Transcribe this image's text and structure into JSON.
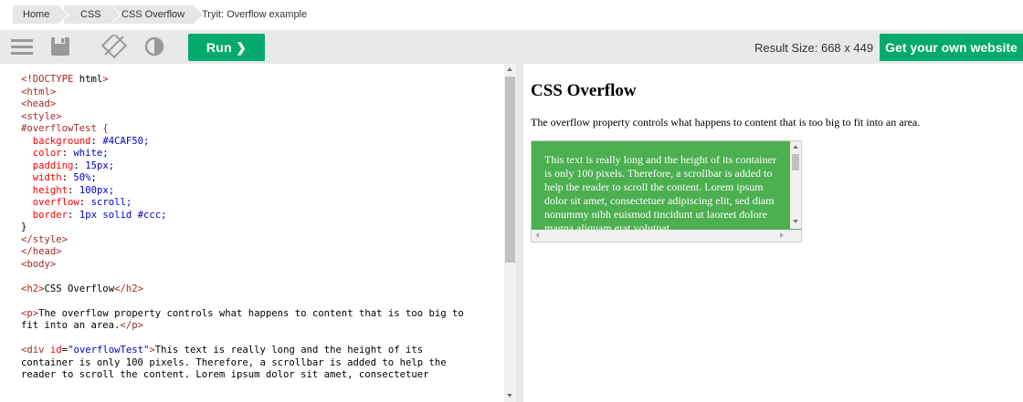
{
  "breadcrumb": {
    "items": [
      "Home",
      "CSS",
      "CSS Overflow",
      "Tryit: Overflow example"
    ]
  },
  "toolbar": {
    "icons": [
      "menu-icon",
      "save-icon",
      "rotate-icon",
      "contrast-icon"
    ],
    "run_label": "Run ❯",
    "result_size": "Result Size: 668 x 449",
    "get_website_label": "Get your own website"
  },
  "code_lines": [
    "<!DOCTYPE html>",
    "<html>",
    "<head>",
    "<style>",
    "#overflowTest {",
    "  background: #4CAF50;",
    "  color: white;",
    "  padding: 15px;",
    "  width: 50%;",
    "  height: 100px;",
    "  overflow: scroll;",
    "  border: 1px solid #ccc;",
    "}",
    "</style>",
    "</head>",
    "<body>",
    "",
    "<h2>CSS Overflow</h2>",
    "",
    "<p>The overflow property controls what happens to content that is too big to",
    "fit into an area.</p>",
    "",
    "<div id=\"overflowTest\">This text is really long and the height of its",
    "container is only 100 pixels. Therefore, a scrollbar is added to help the",
    "reader to scroll the content. Lorem ipsum dolor sit amet, consectetuer"
  ],
  "result": {
    "heading": "CSS Overflow",
    "paragraph": "The overflow property controls what happens to content that is too big to fit into an area.",
    "overflow_text": "This text is really long and the height of its container is only 100 pixels. Therefore, a scrollbar is added to help the reader to scroll the content. Lorem ipsum dolor sit amet, consectetuer adipiscing elit, sed diam nonummy nibh euismod tincidunt ut laoreet dolore magna aliquam erat volutpat."
  },
  "colors": {
    "accent_green": "#04aa6d",
    "overflow_bg": "#4CAF50",
    "toolbar_bg": "#e7e9eb"
  }
}
